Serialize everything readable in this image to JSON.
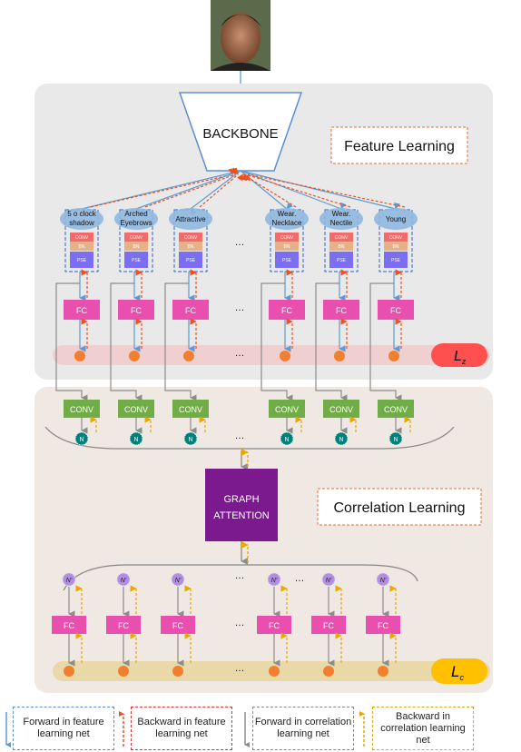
{
  "backbone": "BACKBONE",
  "feature_learning": "Feature Learning",
  "correlation_learning": "Correlation Learning",
  "graph_attention": [
    "GRAPH",
    "ATTENTION"
  ],
  "loss_feature": "L",
  "loss_feature_sub": "z",
  "loss_corr": "L",
  "loss_corr_sub": "c",
  "ellipsis": "…",
  "attributes": [
    [
      "5 o clock",
      "shadow"
    ],
    [
      "Arched",
      "Eyebrows"
    ],
    [
      "Attractive"
    ],
    [
      "Wear.",
      "Necklace"
    ],
    [
      "Wear.",
      "Nectile"
    ],
    [
      "Young"
    ]
  ],
  "block_labels": {
    "conv_small": "CONV",
    "bn": "BN",
    "pse": "PSE",
    "fc": "FC",
    "conv": "CONV",
    "node": "N",
    "node_prime": "N'"
  },
  "colors": {
    "feature_panel": "#e9e9e9",
    "correlation_panel": "#efe8e3",
    "fc": "#e84fae",
    "conv_green": "#70ad47",
    "node": "#00807a",
    "node_prime": "#b28ee3",
    "graph_attention": "#7a1a8e",
    "forward_feature": "#5b9bd5",
    "backward_feature": "#f0501e",
    "forward_corr": "#8c8c8c",
    "backward_corr": "#e8a800",
    "loss_feature": "#ff5050",
    "loss_corr": "#ffc000"
  },
  "legend": [
    {
      "icon": "arrow-down-blue",
      "label": "Forward in feature learning net"
    },
    {
      "icon": "arrow-up-red-dashed",
      "label": "Backward in feature learning net"
    },
    {
      "icon": "arrow-down-gray",
      "label": "Forward in correlation learning net"
    },
    {
      "icon": "arrow-up-yellow-dashed",
      "label": "Backward in correlation learning net"
    }
  ]
}
